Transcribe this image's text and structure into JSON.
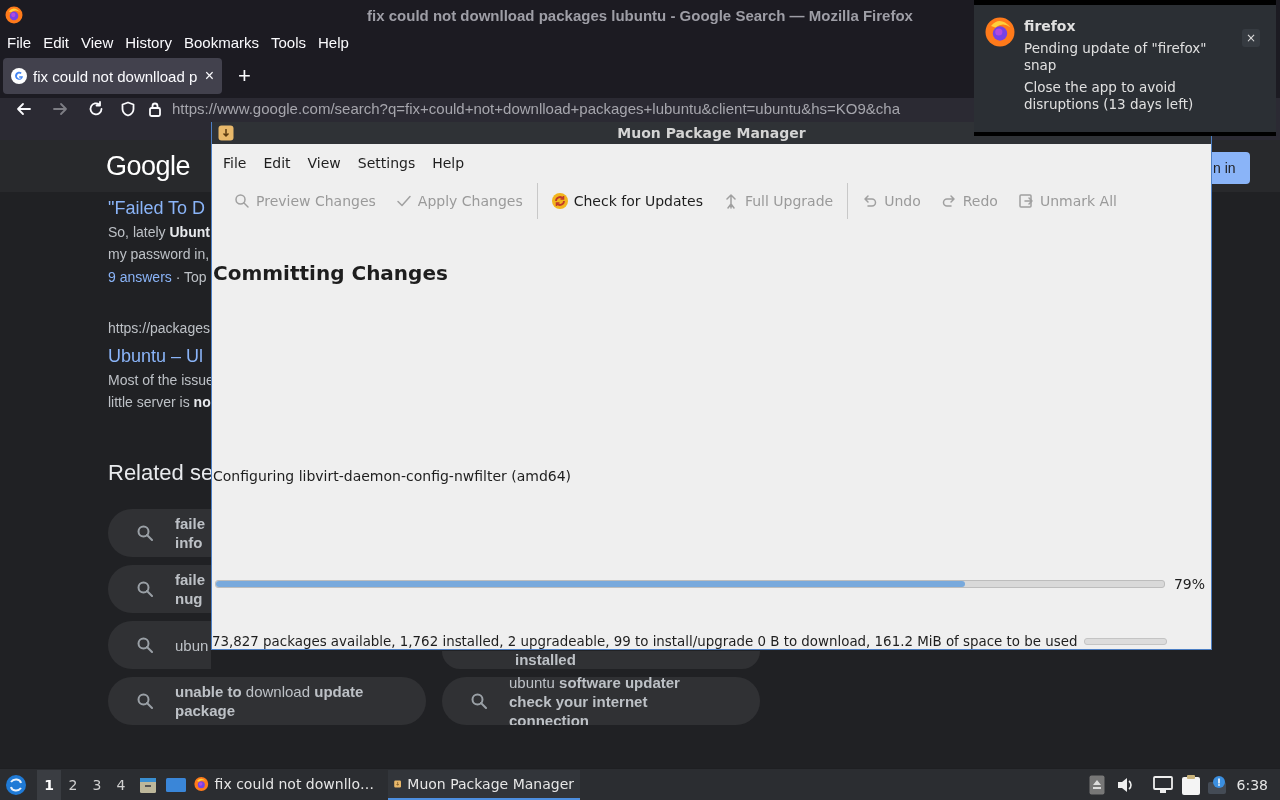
{
  "firefox": {
    "title": "fix could not downlload packages lubuntu - Google Search — Mozilla Firefox",
    "menu": [
      "File",
      "Edit",
      "View",
      "History",
      "Bookmarks",
      "Tools",
      "Help"
    ],
    "tab": {
      "title": "fix could not downlload p",
      "close": "×",
      "selected": true
    },
    "new_tab": "+",
    "url": "https://www.google.com/search?q=fix+could+not+downlload+packages+lubuntu&client=ubuntu&hs=KO9&cha"
  },
  "google": {
    "logo": "Google",
    "sign_in": "n in",
    "results": [
      {
        "title": "\"Failed To D",
        "snippet": [
          "So, lately **Ubunt**",
          "my password in,"
        ],
        "meta_link": "9 answers",
        "meta": "· Top"
      },
      {
        "url": "https://packages",
        "title": "Ubuntu – Ul",
        "snippet": [
          "Most of the issue",
          "little server is **no**"
        ]
      }
    ],
    "related_heading": "Related se",
    "related_left": [
      {
        "lines": [
          "**faile**",
          "**info**"
        ]
      },
      {
        "lines": [
          "**faile**",
          "**nug**"
        ]
      },
      {
        "lines": [
          "ubun"
        ]
      },
      {
        "lines": [
          "**unable to** download **update**",
          "**package**"
        ]
      }
    ],
    "related_right": [
      {
        "lines": [
          "**installed**"
        ]
      },
      {
        "lines": [
          "ubuntu **software updater**",
          "**check your internet**",
          "**connection**"
        ]
      }
    ]
  },
  "muon": {
    "title": "Muon Package Manager",
    "menu": [
      "File",
      "Edit",
      "View",
      "Settings",
      "Help"
    ],
    "toolbar": [
      {
        "kind": "action",
        "label": "Preview Changes",
        "disabled": true
      },
      {
        "kind": "action",
        "label": "Apply Changes",
        "disabled": true
      },
      {
        "kind": "separator"
      },
      {
        "kind": "action",
        "label": "Check for Updates",
        "disabled": false
      },
      {
        "kind": "action",
        "label": "Full Upgrade",
        "disabled": true
      },
      {
        "kind": "separator"
      },
      {
        "kind": "action",
        "label": "Undo",
        "disabled": true
      },
      {
        "kind": "action",
        "label": "Redo",
        "disabled": true
      },
      {
        "kind": "action",
        "label": "Unmark All",
        "disabled": true
      }
    ],
    "heading": "Committing Changes",
    "status": "Configuring libvirt-daemon-config-nwfilter (amd64)",
    "progress": {
      "level": 0.79,
      "reading": "79%"
    },
    "statusbar_progress": {
      "level": 0
    },
    "statusbar": "73,827 packages available, 1,762 installed, 2 upgradeable, 99 to install/upgrade 0 B to download, 161.2 MiB of space to be used"
  },
  "notification": {
    "app": "firefox",
    "close": "×",
    "lines": [
      "Pending update of \"firefox\" snap",
      "Close the app to avoid disruptions (13 days left)"
    ]
  },
  "taskbar": {
    "workspaces": [
      {
        "label": "1",
        "selected": true
      },
      {
        "label": "2",
        "selected": false
      },
      {
        "label": "3",
        "selected": false
      },
      {
        "label": "4",
        "selected": false
      }
    ],
    "tasks": [
      {
        "title": "fix could not downllo…",
        "selected": false
      },
      {
        "title": "Muon Package Manager",
        "selected": true
      }
    ],
    "clock": "6:38"
  }
}
